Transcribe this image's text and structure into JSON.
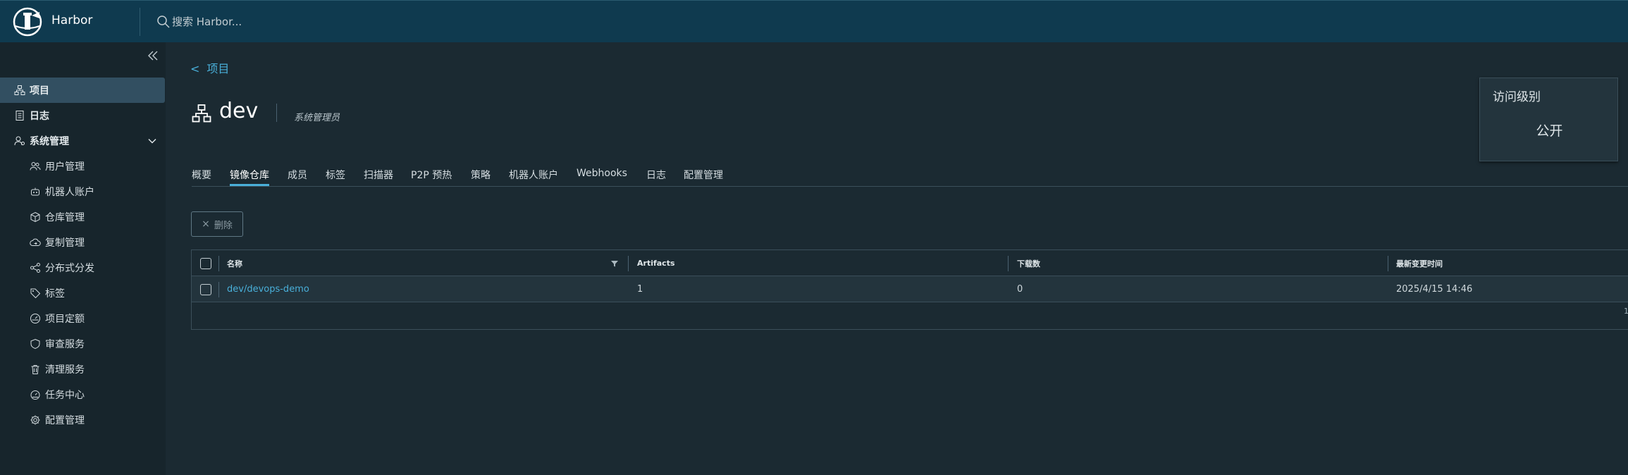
{
  "header": {
    "app_title": "Harbor",
    "search_placeholder": "搜索 Harbor..."
  },
  "sidebar": {
    "items": [
      {
        "label": "项目",
        "icon": "project-icon",
        "active": true
      },
      {
        "label": "日志",
        "icon": "log-icon"
      },
      {
        "label": "系统管理",
        "icon": "admin-icon",
        "expanded": true
      }
    ],
    "sub_items": [
      {
        "label": "用户管理",
        "icon": "users-icon"
      },
      {
        "label": "机器人账户",
        "icon": "robot-icon"
      },
      {
        "label": "仓库管理",
        "icon": "registry-icon"
      },
      {
        "label": "复制管理",
        "icon": "replication-icon"
      },
      {
        "label": "分布式分发",
        "icon": "distribution-icon"
      },
      {
        "label": "标签",
        "icon": "tag-icon"
      },
      {
        "label": "项目定额",
        "icon": "quota-icon"
      },
      {
        "label": "审查服务",
        "icon": "shield-icon"
      },
      {
        "label": "清理服务",
        "icon": "trash-icon"
      },
      {
        "label": "任务中心",
        "icon": "job-icon"
      },
      {
        "label": "配置管理",
        "icon": "gear-icon"
      }
    ]
  },
  "breadcrumb": {
    "arrow": "<",
    "label": "项目"
  },
  "project": {
    "name": "dev",
    "role": "系统管理员"
  },
  "access": {
    "label": "访问级别",
    "value": "公开"
  },
  "tabs": [
    {
      "label": "概要"
    },
    {
      "label": "镜像仓库",
      "active": true
    },
    {
      "label": "成员"
    },
    {
      "label": "标签"
    },
    {
      "label": "扫描器"
    },
    {
      "label": "P2P 预热"
    },
    {
      "label": "策略"
    },
    {
      "label": "机器人账户"
    },
    {
      "label": "Webhooks"
    },
    {
      "label": "日志"
    },
    {
      "label": "配置管理"
    }
  ],
  "toolbar": {
    "delete_icon": "×",
    "delete_label": "删除"
  },
  "table": {
    "columns": [
      "名称",
      "Artifacts",
      "下载数",
      "最新变更时间"
    ],
    "rows": [
      {
        "name": "dev/devops-demo",
        "artifacts": "1",
        "downloads": "0",
        "updated": "2025/4/15 14:46"
      }
    ],
    "footer_hint": "1"
  },
  "colors": {
    "accent": "#49afd9",
    "header_bg": "#0f3a4f",
    "sidebar_bg": "#17252c",
    "body_bg": "#1b2a32"
  }
}
